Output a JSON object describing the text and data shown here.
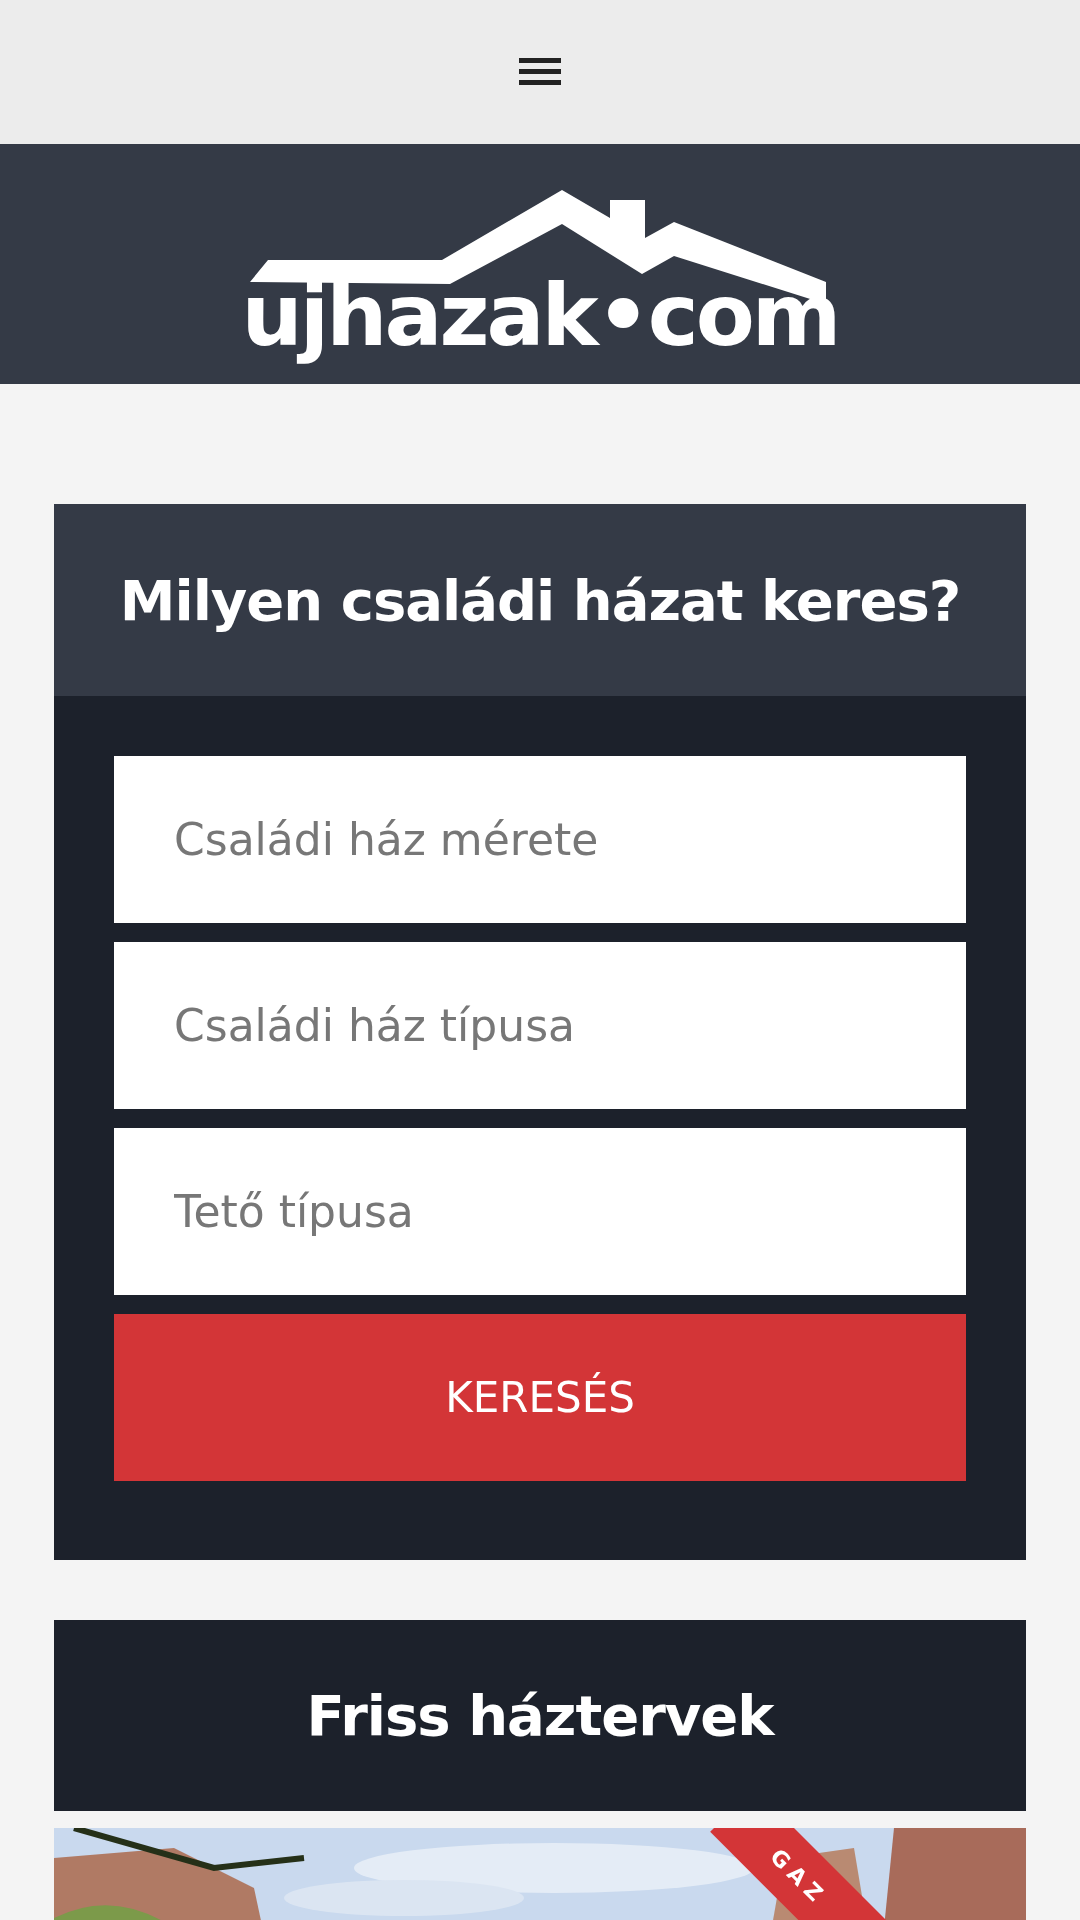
{
  "logo": {
    "text": "ujhazak•com"
  },
  "search_card": {
    "title": "Milyen családi házat keres?",
    "fields": [
      {
        "placeholder": "Családi ház mérete"
      },
      {
        "placeholder": "Családi ház típusa"
      },
      {
        "placeholder": "Tető típusa"
      }
    ],
    "button": "KERESÉS"
  },
  "listing_card": {
    "title": "Friss háztervek",
    "ribbon": "GAZ"
  }
}
